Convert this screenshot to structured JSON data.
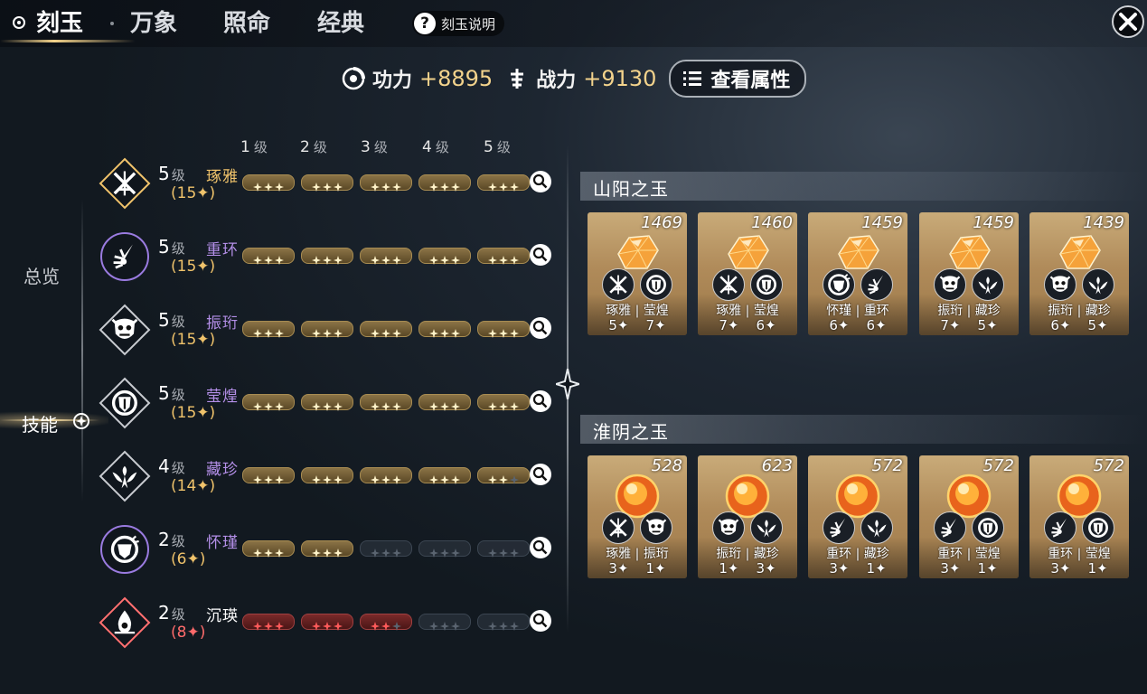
{
  "tabs": [
    {
      "label": "刻玉",
      "active": true
    },
    {
      "label": "万象",
      "active": false
    },
    {
      "label": "照命",
      "active": false
    },
    {
      "label": "经典",
      "active": false
    }
  ],
  "help_label": "刻玉说明",
  "stats": {
    "gongli_label": "功力",
    "gongli_value": "+8895",
    "zhanli_label": "战力",
    "zhanli_value": "+9130",
    "attr_button": "查看属性"
  },
  "sidebar": {
    "items": [
      {
        "label": "总览",
        "active": false
      },
      {
        "label": "技能",
        "active": true
      }
    ]
  },
  "level_headers": [
    {
      "num": "1",
      "unit": "级"
    },
    {
      "num": "2",
      "unit": "级"
    },
    {
      "num": "3",
      "unit": "级"
    },
    {
      "num": "4",
      "unit": "级"
    },
    {
      "num": "5",
      "unit": "级"
    }
  ],
  "skills": [
    {
      "level": "5",
      "level_unit": "级",
      "name": "琢雅",
      "count": "(15✦)",
      "name_color": "#f0c36b",
      "count_color": "#f0c36b",
      "tier": "gold",
      "filled": 15,
      "icon": "crossed-swords-icon"
    },
    {
      "level": "5",
      "level_unit": "级",
      "name": "重环",
      "count": "(15✦)",
      "name_color": "#b48fe8",
      "count_color": "#f0c36b",
      "tier": "gold",
      "filled": 15,
      "icon": "blade-burst-icon"
    },
    {
      "level": "5",
      "level_unit": "级",
      "name": "振珩",
      "count": "(15✦)",
      "name_color": "#b48fe8",
      "count_color": "#f0c36b",
      "tier": "gold",
      "filled": 15,
      "icon": "demon-mask-icon"
    },
    {
      "level": "5",
      "level_unit": "级",
      "name": "莹煌",
      "count": "(15✦)",
      "name_color": "#b48fe8",
      "count_color": "#f0c36b",
      "tier": "gold",
      "filled": 15,
      "icon": "shield-crest-icon"
    },
    {
      "level": "4",
      "level_unit": "级",
      "name": "藏珍",
      "count": "(14✦)",
      "name_color": "#b48fe8",
      "count_color": "#f0c36b",
      "tier": "gold",
      "filled": 14,
      "icon": "phoenix-icon"
    },
    {
      "level": "2",
      "level_unit": "级",
      "name": "怀瑾",
      "count": "(6✦)",
      "name_color": "#b48fe8",
      "count_color": "#f0c36b",
      "tier": "gold",
      "filled": 6,
      "icon": "round-shield-icon"
    },
    {
      "level": "2",
      "level_unit": "级",
      "name": "沉瑛",
      "count": "(8✦)",
      "name_color": "#ffffff",
      "count_color": "#ff6b6b",
      "tier": "red",
      "filled": 8,
      "icon": "flame-drop-icon"
    }
  ],
  "sections": [
    {
      "title": "山阳之玉",
      "gem": "faceted-orange-gem",
      "cards": [
        {
          "score": "1469",
          "icons": [
            "crossed-swords-icon",
            "shield-crest-icon"
          ],
          "name_a": "琢雅",
          "name_b": "莹煌",
          "num_a": "5✦",
          "num_b": "7✦"
        },
        {
          "score": "1460",
          "icons": [
            "crossed-swords-icon",
            "shield-crest-icon"
          ],
          "name_a": "琢雅",
          "name_b": "莹煌",
          "num_a": "7✦",
          "num_b": "6✦"
        },
        {
          "score": "1459",
          "icons": [
            "round-shield-icon",
            "blade-burst-icon"
          ],
          "name_a": "怀瑾",
          "name_b": "重环",
          "num_a": "6✦",
          "num_b": "6✦"
        },
        {
          "score": "1459",
          "icons": [
            "demon-mask-icon",
            "phoenix-icon"
          ],
          "name_a": "振珩",
          "name_b": "藏珍",
          "num_a": "7✦",
          "num_b": "5✦"
        },
        {
          "score": "1439",
          "icons": [
            "demon-mask-icon",
            "phoenix-icon"
          ],
          "name_a": "振珩",
          "name_b": "藏珍",
          "num_a": "6✦",
          "num_b": "5✦"
        }
      ]
    },
    {
      "title": "淮阴之玉",
      "gem": "round-fire-orb",
      "cards": [
        {
          "score": "528",
          "icons": [
            "crossed-swords-icon",
            "demon-mask-icon"
          ],
          "name_a": "琢雅",
          "name_b": "振珩",
          "num_a": "3✦",
          "num_b": "1✦"
        },
        {
          "score": "623",
          "icons": [
            "demon-mask-icon",
            "phoenix-icon"
          ],
          "name_a": "振珩",
          "name_b": "藏珍",
          "num_a": "1✦",
          "num_b": "3✦"
        },
        {
          "score": "572",
          "icons": [
            "blade-burst-icon",
            "phoenix-icon"
          ],
          "name_a": "重环",
          "name_b": "藏珍",
          "num_a": "3✦",
          "num_b": "1✦"
        },
        {
          "score": "572",
          "icons": [
            "blade-burst-icon",
            "shield-crest-icon"
          ],
          "name_a": "重环",
          "name_b": "莹煌",
          "num_a": "3✦",
          "num_b": "1✦"
        },
        {
          "score": "572",
          "icons": [
            "blade-burst-icon",
            "shield-crest-icon"
          ],
          "name_a": "重环",
          "name_b": "莹煌",
          "num_a": "3✦",
          "num_b": "1✦"
        }
      ]
    }
  ],
  "colors": {
    "gold": "#f3d38c",
    "purple": "#b48fe8",
    "red": "#ff5a5a"
  }
}
